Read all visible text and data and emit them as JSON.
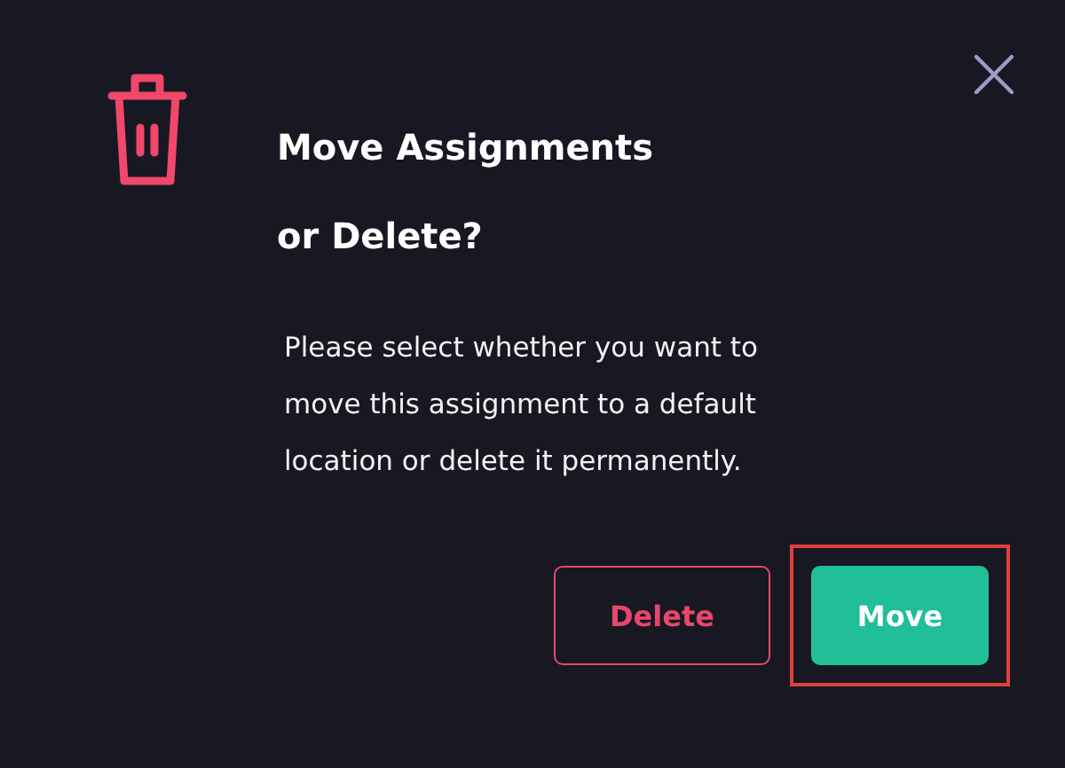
{
  "dialog": {
    "title_lines": [
      "Move Assignments",
      "or Delete?"
    ],
    "message": [
      "Please select whether you want to",
      "move this assignment to a default",
      "location or delete it permanently."
    ],
    "buttons": [
      {
        "label": "Delete",
        "kind": "outline",
        "highlighted": false
      },
      {
        "label": "Move",
        "kind": "primary",
        "highlighted": true
      }
    ]
  }
}
